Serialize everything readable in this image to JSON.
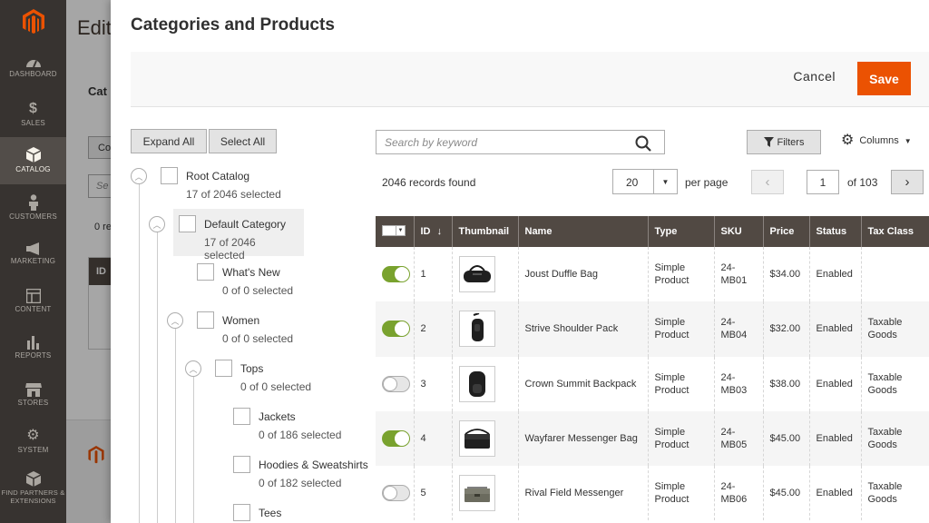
{
  "admin_nav": {
    "items": [
      {
        "label": "DASHBOARD",
        "icon": "dashboard-icon"
      },
      {
        "label": "SALES",
        "icon": "dollar-icon"
      },
      {
        "label": "CATALOG",
        "icon": "cube-icon",
        "active": true
      },
      {
        "label": "CUSTOMERS",
        "icon": "person-icon"
      },
      {
        "label": "MARKETING",
        "icon": "megaphone-icon"
      },
      {
        "label": "CONTENT",
        "icon": "layout-icon"
      },
      {
        "label": "REPORTS",
        "icon": "bar-chart-icon"
      },
      {
        "label": "STORES",
        "icon": "store-icon"
      },
      {
        "label": "SYSTEM",
        "icon": "gear-icon"
      },
      {
        "label": "FIND PARTNERS & EXTENSIONS",
        "icon": "box-icon"
      }
    ]
  },
  "background": {
    "title": "Edit",
    "section_label": "Cat",
    "button_label": "Co",
    "search_fragment": "Se",
    "records_fragment": "0 re",
    "id_header": "ID"
  },
  "modal": {
    "title": "Categories and Products",
    "cancel_label": "Cancel",
    "save_label": "Save"
  },
  "tree": {
    "expand_all_label": "Expand All",
    "select_all_label": "Select All",
    "nodes": [
      {
        "name": "Root Catalog",
        "count": "17 of 2046 selected"
      },
      {
        "name": "Default Category",
        "count": "17 of 2046 selected"
      },
      {
        "name": "What's New",
        "count": "0 of 0 selected"
      },
      {
        "name": "Women",
        "count": "0 of 0 selected"
      },
      {
        "name": "Tops",
        "count": "0 of 0 selected"
      },
      {
        "name": "Jackets",
        "count": "0 of 186 selected"
      },
      {
        "name": "Hoodies & Sweatshirts",
        "count": "0 of 182 selected"
      },
      {
        "name": "Tees",
        "count": ""
      }
    ]
  },
  "grid": {
    "search_placeholder": "Search by keyword",
    "filters_label": "Filters",
    "columns_label": "Columns",
    "records_found": "2046 records found",
    "per_page_value": "20",
    "per_page_label": "per page",
    "current_page": "1",
    "total_pages_label": "of 103",
    "headers": {
      "id": "ID",
      "id_sort": "↓",
      "thumbnail": "Thumbnail",
      "name": "Name",
      "type": "Type",
      "sku": "SKU",
      "price": "Price",
      "status": "Status",
      "tax_class": "Tax Class"
    },
    "rows": [
      {
        "selected": true,
        "id": "1",
        "name": "Joust Duffle Bag",
        "type": "Simple Product",
        "sku": "24-MB01",
        "price": "$34.00",
        "status": "Enabled",
        "tax_class": "",
        "thumbnail": "duffle-bag-icon"
      },
      {
        "selected": true,
        "id": "2",
        "name": "Strive Shoulder Pack",
        "type": "Simple Product",
        "sku": "24-MB04",
        "price": "$32.00",
        "status": "Enabled",
        "tax_class": "Taxable Goods",
        "thumbnail": "shoulder-pack-icon"
      },
      {
        "selected": false,
        "id": "3",
        "name": "Crown Summit Backpack",
        "type": "Simple Product",
        "sku": "24-MB03",
        "price": "$38.00",
        "status": "Enabled",
        "tax_class": "Taxable Goods",
        "thumbnail": "backpack-icon"
      },
      {
        "selected": true,
        "id": "4",
        "name": "Wayfarer Messenger Bag",
        "type": "Simple Product",
        "sku": "24-MB05",
        "price": "$45.00",
        "status": "Enabled",
        "tax_class": "Taxable Goods",
        "thumbnail": "messenger-bag-icon"
      },
      {
        "selected": false,
        "id": "5",
        "name": "Rival Field Messenger",
        "type": "Simple Product",
        "sku": "24-MB06",
        "price": "$45.00",
        "status": "Enabled",
        "tax_class": "Taxable Goods",
        "thumbnail": "field-messenger-icon"
      }
    ]
  },
  "colors": {
    "accent": "#eb5202",
    "sidebar": "#373330",
    "table_header": "#514943",
    "toggle_on": "#79a22e"
  }
}
